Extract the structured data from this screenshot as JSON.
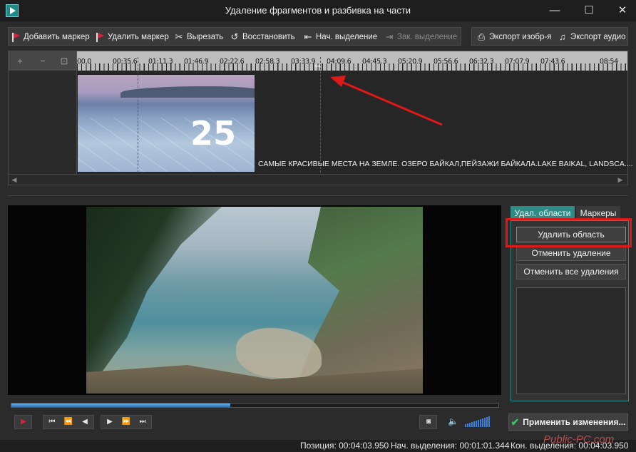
{
  "window": {
    "title": "Удаление фрагментов и разбивка на части",
    "minimize_glyph": "—",
    "maximize_glyph": "☐",
    "close_glyph": "✕"
  },
  "toolbar": {
    "add_marker": "Добавить маркер",
    "remove_marker": "Удалить маркер",
    "cut": "Вырезать",
    "restore": "Восстановить",
    "start_selection": "Нач. выделение",
    "end_selection": "Зак. выделение",
    "export_image": "Экспорт изобр-я",
    "export_audio": "Экспорт аудио"
  },
  "timeline": {
    "ruler_labels": [
      "00.0",
      "00:35.6",
      "01:11.3",
      "01:46.9",
      "02:22.6",
      "02:58.3",
      "03:33.9",
      "04:09.6",
      "04:45.3",
      "05:20.9",
      "05:56.6",
      "06:32.3",
      "07:07.9",
      "07:43.6",
      "08:54"
    ],
    "clip_title": "САМЫЕ КРАСИВЫЕ МЕСТА НА ЗЕМЛЕ. ОЗЕРО БАЙКАЛ,ПЕЙЗАЖИ БАЙКАЛА.LAKE BAIKAL, LANDSCA....",
    "thumbnail_number": "25"
  },
  "playback": {
    "progress_fraction": 0.45,
    "volume_bars": 12
  },
  "side_panel": {
    "tabs": [
      "Удал. области",
      "Маркеры"
    ],
    "active_tab": "Удал. области",
    "delete_region": "Удалить область",
    "undo_delete": "Отменить удаление",
    "undo_all_deletes": "Отменить все удаления"
  },
  "apply_button": "Применить изменения...",
  "status": {
    "position": "Позиция: 00:04:03.950",
    "selection_start": "Нач. выделения: 00:01:01.344",
    "selection_end": "Кон. выделения: 00:04:03.950"
  },
  "watermark": "Public-PC.com",
  "colors": {
    "accent_teal": "#2d8c86",
    "marker_red": "#e0203a",
    "apply_check_green": "#3fc46a",
    "volume_blue": "#3a7fd8"
  }
}
